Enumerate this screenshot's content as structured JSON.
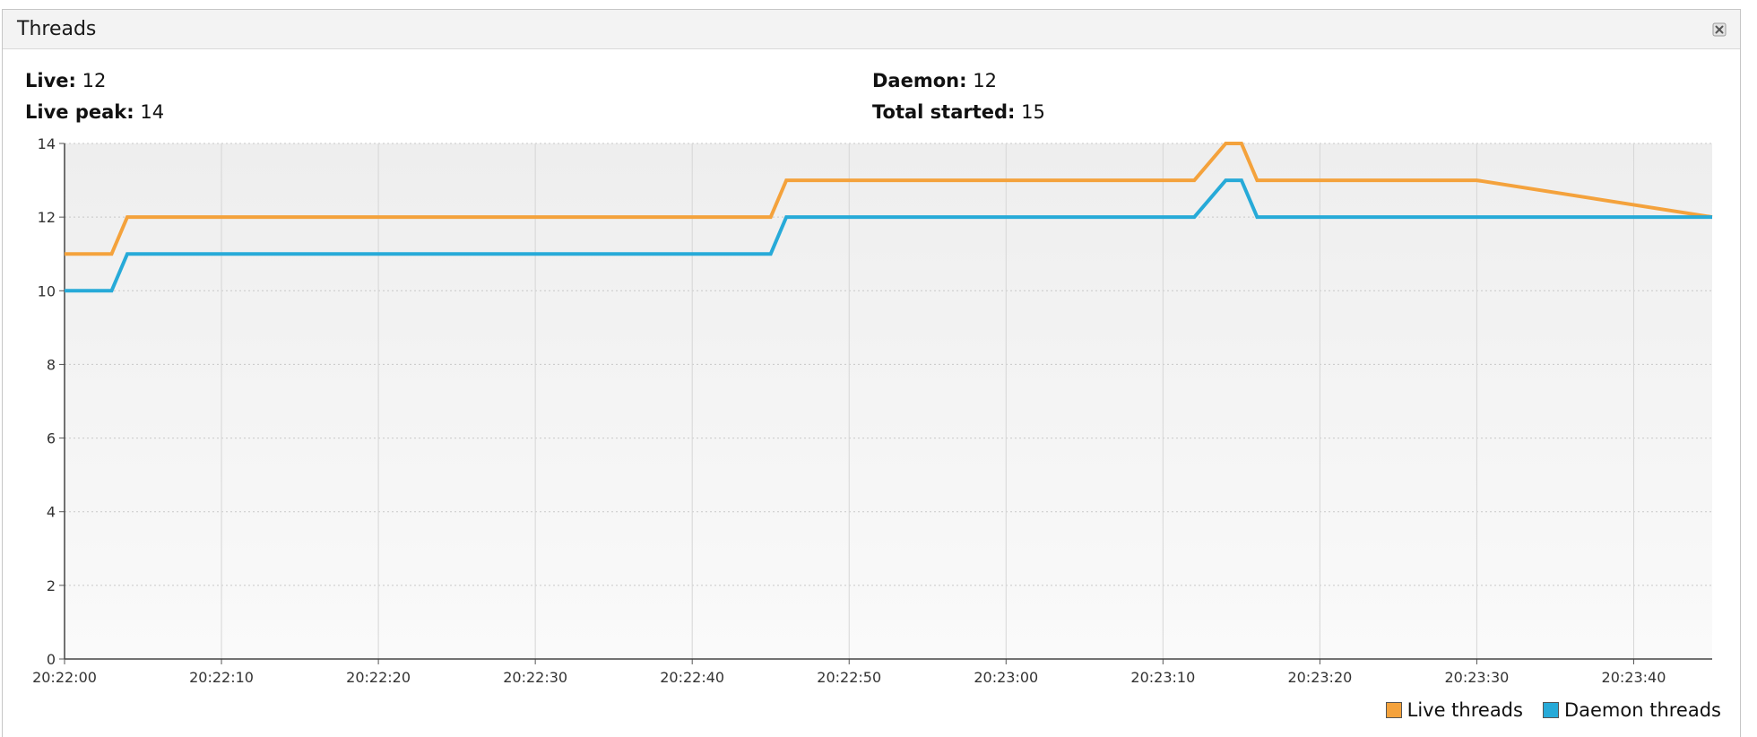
{
  "window": {
    "title": "Threads",
    "close_icon": "close-icon"
  },
  "stats": {
    "live_label": "Live:",
    "live_value": "12",
    "live_peak_label": "Live peak:",
    "live_peak_value": "14",
    "daemon_label": "Daemon:",
    "daemon_value": "12",
    "total_started_label": "Total started:",
    "total_started_value": "15"
  },
  "colors": {
    "live": "#f4a23c",
    "daemon": "#27aad8",
    "plot_bg_top": "#eeeeee",
    "plot_bg_bottom": "#fafafa",
    "grid": "#c8c8c8"
  },
  "chart_data": {
    "type": "line",
    "ylim": [
      0,
      14
    ],
    "yticks": [
      "0",
      "2",
      "4",
      "6",
      "8",
      "10",
      "12",
      "14"
    ],
    "xlim": [
      "20:22:00",
      "20:23:45"
    ],
    "xticks": [
      "20:22:00",
      "20:22:10",
      "20:22:20",
      "20:22:30",
      "20:22:40",
      "20:22:50",
      "20:23:00",
      "20:23:10",
      "20:23:20",
      "20:23:30",
      "20:23:40"
    ],
    "grid": true,
    "legend_position": "bottom-right",
    "series": [
      {
        "name": "Live threads",
        "points": [
          [
            "20:22:00",
            11
          ],
          [
            "20:22:03",
            11
          ],
          [
            "20:22:04",
            12
          ],
          [
            "20:22:45",
            12
          ],
          [
            "20:22:46",
            13
          ],
          [
            "20:23:12",
            13
          ],
          [
            "20:23:14",
            14
          ],
          [
            "20:23:15",
            14
          ],
          [
            "20:23:16",
            13
          ],
          [
            "20:23:30",
            13
          ],
          [
            "20:23:45",
            12
          ]
        ]
      },
      {
        "name": "Daemon threads",
        "points": [
          [
            "20:22:00",
            10
          ],
          [
            "20:22:03",
            10
          ],
          [
            "20:22:04",
            11
          ],
          [
            "20:22:45",
            11
          ],
          [
            "20:22:46",
            12
          ],
          [
            "20:23:12",
            12
          ],
          [
            "20:23:14",
            13
          ],
          [
            "20:23:15",
            13
          ],
          [
            "20:23:16",
            12
          ],
          [
            "20:23:45",
            12
          ]
        ]
      }
    ]
  }
}
